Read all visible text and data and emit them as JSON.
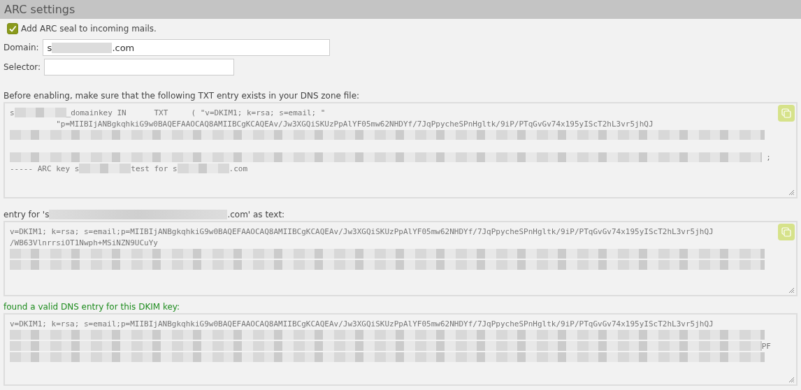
{
  "section": {
    "title": "ARC settings"
  },
  "seal_checkbox": {
    "label": "Add ARC seal to incoming mails.",
    "checked": true
  },
  "domain": {
    "label": "Domain:",
    "value": [
      {
        "kind": "text",
        "text": "s"
      },
      {
        "kind": "redacted"
      },
      {
        "kind": "text",
        "text": ".com"
      }
    ]
  },
  "selector": {
    "label": "Selector:"
  },
  "dns_zone": {
    "label": "Before enabling, make sure that the following TXT entry exists in your DNS zone file:",
    "lines": [
      [
        {
          "kind": "text",
          "text": "s"
        },
        {
          "kind": "redacted"
        },
        {
          "kind": "text",
          "text": "_domainkey IN      TXT     ( \"v=DKIM1; k=rsa; s=email; \""
        }
      ],
      [
        {
          "kind": "text",
          "text": "          \"p=MIIBIjANBgkqhkiG9w0BAQEFAAOCAQ8AMIIBCgKCAQEAv/Jw3XGQiSKUzPpAlYF05mw62NHDYf/7JqPpycheSPnHgltk/9iP/PTqGvGv74x195yIScT2hL3vr5jhQJ"
        }
      ],
      [
        {
          "kind": "redacted_line"
        }
      ],
      [
        {
          "kind": "gap"
        }
      ],
      [
        {
          "kind": "redacted_line"
        },
        {
          "kind": "text",
          "text": " ;"
        }
      ],
      [
        {
          "kind": "text",
          "text": "----- ARC key s"
        },
        {
          "kind": "redacted"
        },
        {
          "kind": "text",
          "text": "test for s"
        },
        {
          "kind": "redacted"
        },
        {
          "kind": "text",
          "text": ".com"
        }
      ]
    ]
  },
  "text_entry": {
    "label": [
      {
        "kind": "text",
        "text": "entry for 's"
      },
      {
        "kind": "redacted_long"
      },
      {
        "kind": "text",
        "text": ".com' as text:"
      }
    ],
    "lines": [
      [
        {
          "kind": "text",
          "text": "v=DKIM1; k=rsa; s=email;p=MIIBIjANBgkqhkiG9w0BAQEFAAOCAQ8AMIIBCgKCAQEAv/Jw3XGQiSKUzPpAlYF05mw62NHDYf/7JqPpycheSPnHgltk/9iP/PTqGvGv74x195yIScT2hL3vr5jhQJ"
        }
      ],
      [
        {
          "kind": "text",
          "text": "/WB63VlnrrsiOT1Nwph+MSiNZN9UCuYy"
        }
      ],
      [
        {
          "kind": "redacted_line"
        }
      ],
      [
        {
          "kind": "redacted_line"
        }
      ]
    ]
  },
  "validation": {
    "message": "found a valid DNS entry for this DKIM key:",
    "valid": true,
    "lines": [
      [
        {
          "kind": "text",
          "text": "v=DKIM1; k=rsa; s=email;p=MIIBIjANBgkqhkiG9w0BAQEFAAOCAQ8AMIIBCgKCAQEAv/Jw3XGQiSKUzPpAlYF05mw62NHDYf/7JqPpycheSPnHgltk/9iP/PTqGvGv74x195yIScT2hL3vr5jhQJ"
        }
      ],
      [
        {
          "kind": "redacted_line"
        }
      ],
      [
        {
          "kind": "redacted_line"
        },
        {
          "kind": "text",
          "text": "PF"
        }
      ],
      [
        {
          "kind": "redacted_line"
        }
      ]
    ]
  }
}
